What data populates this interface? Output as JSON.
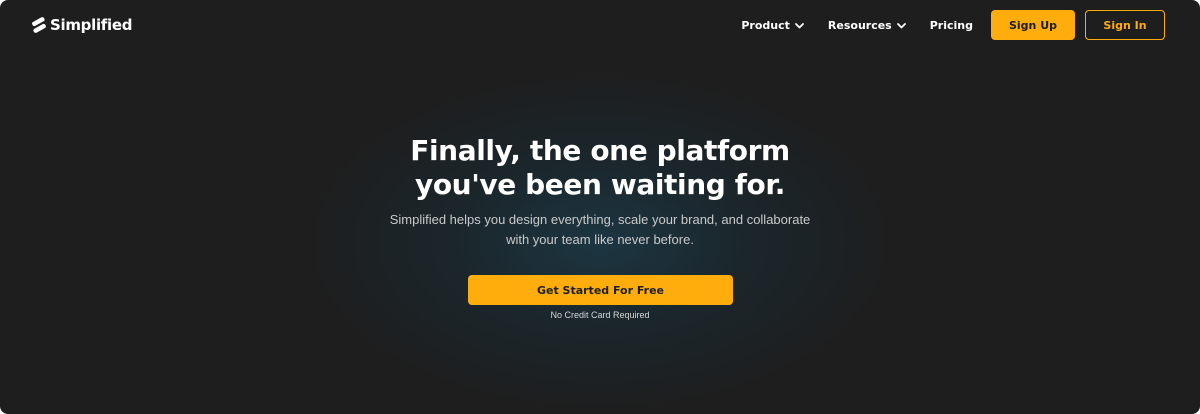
{
  "brand": {
    "name": "Simplified",
    "accent_color": "#ffad0d",
    "background_color": "#1e1e1e"
  },
  "nav": {
    "items": [
      {
        "label": "Product",
        "icon": "chevron-down-icon"
      },
      {
        "label": "Resources",
        "icon": "chevron-down-icon"
      },
      {
        "label": "Pricing"
      }
    ],
    "signup_label": "Sign Up",
    "signin_label": "Sign In"
  },
  "hero": {
    "title_line1": "Finally, the one platform",
    "title_line2": "you've been waiting for.",
    "subtitle_line1": "Simplified helps you design everything, scale your brand, and collaborate",
    "subtitle_line2": "with your team like never before.",
    "cta_label": "Get Started For Free",
    "note": "No Credit Card Required"
  }
}
